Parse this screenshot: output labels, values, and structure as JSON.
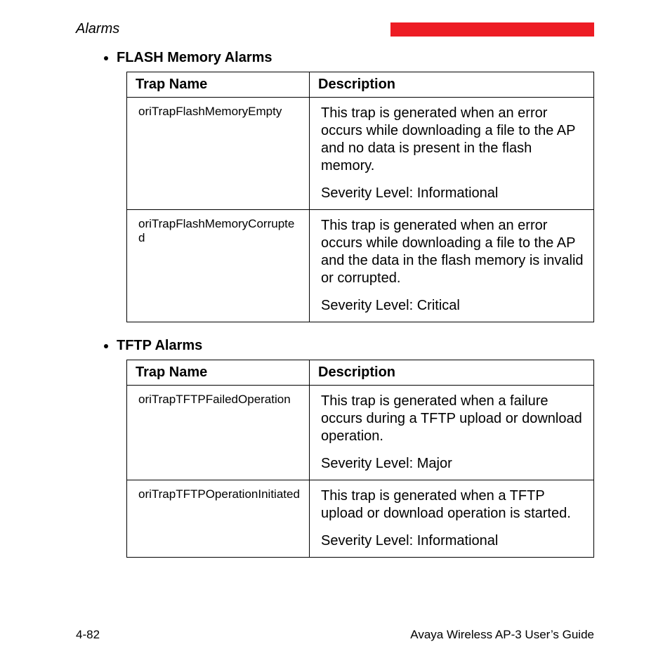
{
  "header": {
    "section": "Alarms"
  },
  "groups": [
    {
      "title": "FLASH Memory Alarms",
      "columns": {
        "trap": "Trap Name",
        "desc": "Description"
      },
      "rows": [
        {
          "trap": "oriTrapFlashMemoryEmpty",
          "desc": "This trap is generated when an error occurs while downloading a file to the AP and no data is present in the flash memory.",
          "severity": "Severity Level: Informational"
        },
        {
          "trap": "oriTrapFlashMemoryCorrupted",
          "desc": "This trap is generated when an error occurs while downloading a file to the AP and the data in the flash memory is invalid or corrupted.",
          "severity": "Severity Level: Critical"
        }
      ]
    },
    {
      "title": "TFTP Alarms",
      "columns": {
        "trap": "Trap Name",
        "desc": "Description"
      },
      "rows": [
        {
          "trap": "oriTrapTFTPFailedOperation",
          "desc": "This trap is generated when a failure occurs during a TFTP upload or download operation.",
          "severity": "Severity Level: Major"
        },
        {
          "trap": "oriTrapTFTPOperationInitiated",
          "desc": "This trap is generated when a TFTP upload or download operation is started.",
          "severity": "Severity Level: Informational"
        }
      ]
    }
  ],
  "footer": {
    "page": "4-82",
    "doc": "Avaya Wireless AP-3 User’s Guide"
  }
}
